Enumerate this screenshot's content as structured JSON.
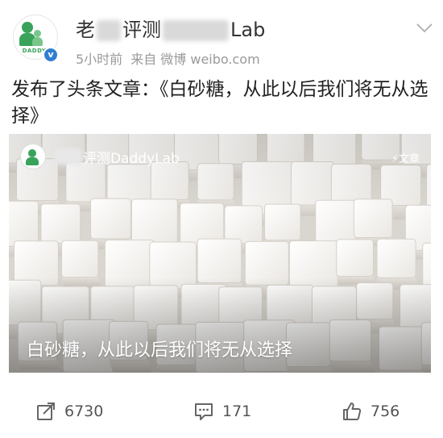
{
  "header": {
    "name_prefix": "老",
    "name_middle": "评测",
    "name_suffix": "Lab",
    "avatar_brand": "DADDYL",
    "verified_mark": "v",
    "time": "5小时前",
    "source": "来自 微博 weibo.com",
    "menu_icon": "chevron-down-icon"
  },
  "post": {
    "text": "发布了头条文章：《白砂糖，从此以后我们将无从选择》"
  },
  "article": {
    "author": "评测DaddyLab",
    "tag": "⚡文章",
    "title": "白砂糖，从此以后我们将无从选择",
    "image": "sugar-cubes-image"
  },
  "actions": {
    "share_count": "6730",
    "comment_count": "171",
    "like_count": "756"
  },
  "colors": {
    "verified": "#2f7fd3",
    "brand_green": "#3aa35b",
    "meta_gray": "#9a9a9a"
  }
}
